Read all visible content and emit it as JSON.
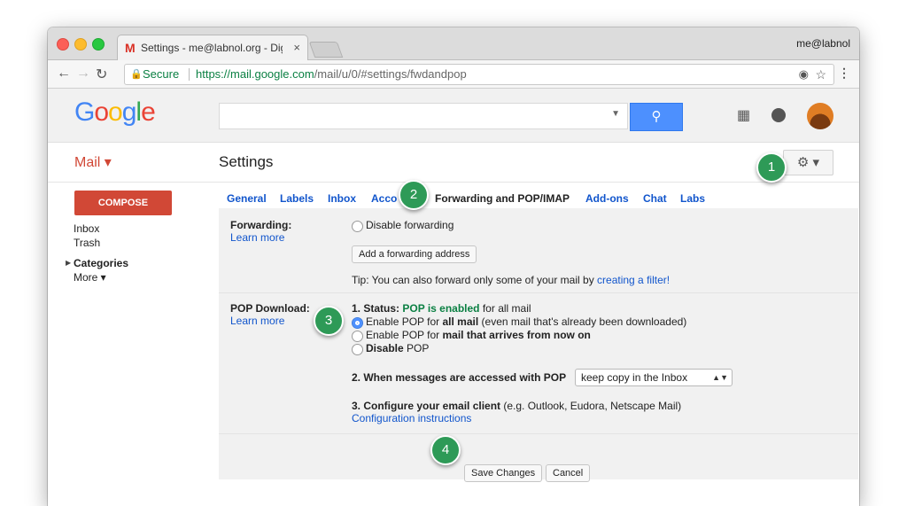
{
  "browser": {
    "tab_title": "Settings - me@labnol.org - Dig",
    "tab_icon": "M",
    "close_glyph": "×",
    "profile": "me@labnol",
    "secure_label": "Secure",
    "url_domain": "https://mail.google.com",
    "url_path": "/mail/u/0/#settings/fwdandpop",
    "icons": [
      "back-arrow-icon",
      "forward-arrow-icon",
      "reload-icon",
      "lock-icon",
      "eye-icon",
      "star-icon",
      "menu-dots-icon"
    ]
  },
  "header": {
    "logo_letters": [
      "G",
      "o",
      "o",
      "g",
      "l",
      "e"
    ],
    "logo_colors": [
      "#4285F4",
      "#EA4335",
      "#FBBC05",
      "#4285F4",
      "#34A853",
      "#EA4335"
    ],
    "search_placeholder": "",
    "search_button_icon": "magnifier-icon"
  },
  "app": {
    "mail_label": "Mail ▾",
    "page_title": "Settings",
    "gear_label": "⚙ ▾"
  },
  "sidebar": {
    "compose": "COMPOSE",
    "items": [
      "Inbox",
      "Trash",
      "Categories",
      "More ▾"
    ]
  },
  "tabs": [
    "General",
    "Labels",
    "Inbox",
    "Acco",
    "Forwarding and POP/IMAP",
    "Add-ons",
    "Chat",
    "Labs"
  ],
  "forwarding": {
    "label": "Forwarding:",
    "learn_more": "Learn more",
    "disable_option": "Disable forwarding",
    "add_button": "Add a forwarding address",
    "tip_prefix": "Tip: You can also forward only some of your mail by ",
    "tip_link": "creating a filter!"
  },
  "pop": {
    "label": "POP Download:",
    "learn_more": "Learn more",
    "status_prefix": "1. Status: ",
    "status_value": "POP is enabled",
    "status_suffix": " for all mail",
    "opt1_prefix": "Enable POP for ",
    "opt1_bold": "all mail",
    "opt1_suffix": " (even mail that's already been downloaded)",
    "opt2_prefix": "Enable POP for ",
    "opt2_bold": "mail that arrives from now on",
    "opt3_bold": "Disable",
    "opt3_suffix": " POP",
    "access_label": "2. When messages are accessed with POP",
    "access_select": "keep copy in the Inbox",
    "client_bold": "3. Configure your email client",
    "client_suffix": " (e.g. Outlook, Eudora, Netscape Mail)",
    "client_link": "Configuration instructions"
  },
  "actions": {
    "save": "Save Changes",
    "cancel": "Cancel"
  },
  "markers": [
    "1",
    "2",
    "3",
    "4"
  ],
  "colors": {
    "accent": "#4d90fe",
    "mail_red": "#d14836",
    "link": "#1155cc",
    "status_green": "#0b8043",
    "marker_green": "#2e9a57"
  }
}
